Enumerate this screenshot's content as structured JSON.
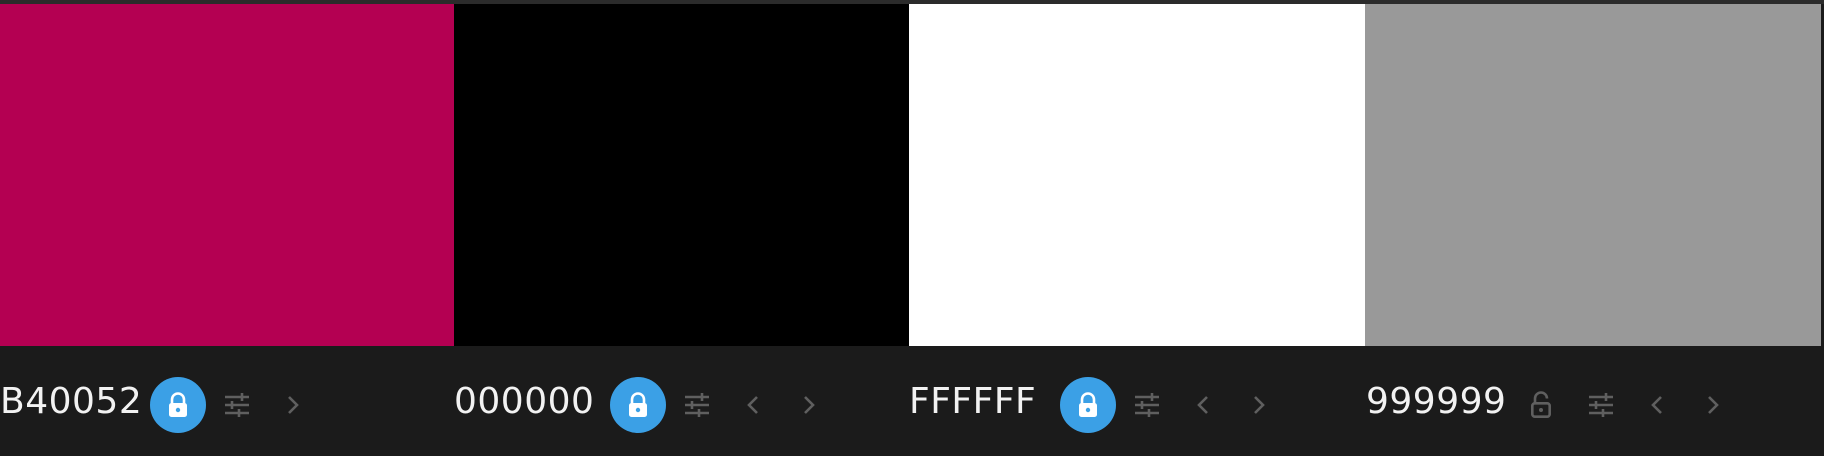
{
  "palette": [
    {
      "hex": "B40052",
      "color": "#B40052",
      "locked": true,
      "icons": [
        "lock-icon",
        "adjust-sliders-icon",
        "chevron-right-icon"
      ]
    },
    {
      "hex": "000000",
      "color": "#000000",
      "locked": true,
      "icons": [
        "lock-icon",
        "adjust-sliders-icon",
        "chevron-left-icon",
        "chevron-right-icon"
      ]
    },
    {
      "hex": "FFFFFF",
      "color": "#FFFFFF",
      "locked": true,
      "icons": [
        "lock-icon",
        "adjust-sliders-icon",
        "chevron-left-icon",
        "chevron-right-icon"
      ]
    },
    {
      "hex": "999999",
      "color": "#999999",
      "locked": false,
      "icons": [
        "unlock-icon",
        "adjust-sliders-icon",
        "chevron-left-icon",
        "chevron-right-icon"
      ]
    }
  ],
  "theme": {
    "background": "#1B1B1B",
    "lock_active": "#3BA0E6",
    "icon_muted": "#5F5F5F",
    "text": "#F2F2F2"
  }
}
